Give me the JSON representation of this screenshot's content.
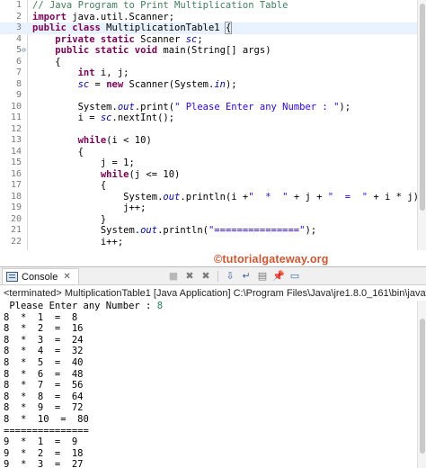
{
  "editor": {
    "lines": [
      {
        "num": "1",
        "fold": "",
        "segs": [
          [
            "cm",
            "// Java Program to Print Multiplication Table"
          ]
        ]
      },
      {
        "num": "2",
        "fold": "",
        "segs": [
          [
            "kw",
            "import"
          ],
          [
            "",
            " java.util.Scanner;"
          ]
        ]
      },
      {
        "num": "3",
        "fold": "",
        "current": true,
        "segs": [
          [
            "kw",
            "public class"
          ],
          [
            "",
            " MultiplicationTable1 "
          ],
          [
            "bracebox",
            "{"
          ]
        ]
      },
      {
        "num": "4",
        "fold": "",
        "segs": [
          [
            "",
            "    "
          ],
          [
            "kw",
            "private static"
          ],
          [
            "",
            " Scanner "
          ],
          [
            "fld",
            "sc"
          ],
          [
            "",
            ";"
          ]
        ]
      },
      {
        "num": "5",
        "fold": "⊖",
        "segs": [
          [
            "",
            "    "
          ],
          [
            "kw",
            "public static void"
          ],
          [
            "",
            " main(String[] args)"
          ]
        ]
      },
      {
        "num": "6",
        "fold": "",
        "segs": [
          [
            "",
            "    {"
          ]
        ]
      },
      {
        "num": "7",
        "fold": "",
        "segs": [
          [
            "",
            "        "
          ],
          [
            "kw",
            "int"
          ],
          [
            "",
            " i, j;"
          ]
        ]
      },
      {
        "num": "8",
        "fold": "",
        "segs": [
          [
            "",
            "        "
          ],
          [
            "fld",
            "sc"
          ],
          [
            "",
            " = "
          ],
          [
            "kw",
            "new"
          ],
          [
            "",
            " Scanner(System."
          ],
          [
            "fld",
            "in"
          ],
          [
            "",
            ");"
          ]
        ]
      },
      {
        "num": "9",
        "fold": "",
        "segs": [
          [
            "",
            ""
          ]
        ]
      },
      {
        "num": "10",
        "fold": "",
        "segs": [
          [
            "",
            "        System."
          ],
          [
            "fld",
            "out"
          ],
          [
            "",
            ".print("
          ],
          [
            "st",
            "\" Please Enter any Number : \""
          ],
          [
            "",
            ");"
          ]
        ]
      },
      {
        "num": "11",
        "fold": "",
        "segs": [
          [
            "",
            "        i = "
          ],
          [
            "fld",
            "sc"
          ],
          [
            "",
            ".nextInt();"
          ]
        ]
      },
      {
        "num": "12",
        "fold": "",
        "segs": [
          [
            "",
            ""
          ]
        ]
      },
      {
        "num": "13",
        "fold": "",
        "segs": [
          [
            "",
            "        "
          ],
          [
            "kw",
            "while"
          ],
          [
            "",
            "(i < 10)"
          ]
        ]
      },
      {
        "num": "14",
        "fold": "",
        "segs": [
          [
            "",
            "        {"
          ]
        ]
      },
      {
        "num": "15",
        "fold": "",
        "segs": [
          [
            "",
            "            j = 1;"
          ]
        ]
      },
      {
        "num": "16",
        "fold": "",
        "segs": [
          [
            "",
            "            "
          ],
          [
            "kw",
            "while"
          ],
          [
            "",
            "(j <= 10)"
          ]
        ]
      },
      {
        "num": "17",
        "fold": "",
        "segs": [
          [
            "",
            "            {"
          ]
        ]
      },
      {
        "num": "18",
        "fold": "",
        "segs": [
          [
            "",
            "                System."
          ],
          [
            "fld",
            "out"
          ],
          [
            "",
            ".println(i +"
          ],
          [
            "st",
            "\"  *  \""
          ],
          [
            "",
            " + j + "
          ],
          [
            "st",
            "\"  =  \""
          ],
          [
            "",
            " + i * j);"
          ]
        ]
      },
      {
        "num": "19",
        "fold": "",
        "segs": [
          [
            "",
            "                j++;"
          ]
        ]
      },
      {
        "num": "20",
        "fold": "",
        "segs": [
          [
            "",
            "            }"
          ]
        ]
      },
      {
        "num": "21",
        "fold": "",
        "segs": [
          [
            "",
            "            System."
          ],
          [
            "fld",
            "out"
          ],
          [
            "",
            ".println("
          ],
          [
            "st",
            "\"===============\""
          ],
          [
            "",
            ");"
          ]
        ]
      },
      {
        "num": "22",
        "fold": "",
        "segs": [
          [
            "",
            "            i++;"
          ]
        ]
      }
    ]
  },
  "watermark": "©tutorialgateway.org",
  "console": {
    "tab_label": "Console",
    "tab_close": "✕",
    "toolbar": [
      {
        "name": "terminate-icon",
        "glyph": "■",
        "cls": "dis"
      },
      {
        "name": "remove-launch-icon",
        "glyph": "✖",
        "cls": "gray"
      },
      {
        "name": "remove-all-terminated-icon",
        "glyph": "✖",
        "cls": "gray"
      },
      {
        "name": "sep",
        "glyph": "",
        "cls": ""
      },
      {
        "name": "scroll-lock-icon",
        "glyph": "⇩",
        "cls": "blue"
      },
      {
        "name": "word-wrap-icon",
        "glyph": "↵",
        "cls": "blue"
      },
      {
        "name": "clear-console-icon",
        "glyph": "▤",
        "cls": "gray"
      },
      {
        "name": "pin-console-icon",
        "glyph": "📌",
        "cls": "blue"
      },
      {
        "name": "display-console-icon",
        "glyph": "▭",
        "cls": "blue"
      }
    ],
    "terminated": "<terminated> MultiplicationTable1 [Java Application] C:\\Program Files\\Java\\jre1.8.0_161\\bin\\javaw.exe (M",
    "prompt": " Please Enter any Number : ",
    "user_input": "8",
    "output": [
      "8  *  1  =  8",
      "8  *  2  =  16",
      "8  *  3  =  24",
      "8  *  4  =  32",
      "8  *  5  =  40",
      "8  *  6  =  48",
      "8  *  7  =  56",
      "8  *  8  =  64",
      "8  *  9  =  72",
      "8  *  10  =  80",
      "===============",
      "9  *  1  =  9",
      "9  *  2  =  18",
      "9  *  3  =  27"
    ]
  }
}
